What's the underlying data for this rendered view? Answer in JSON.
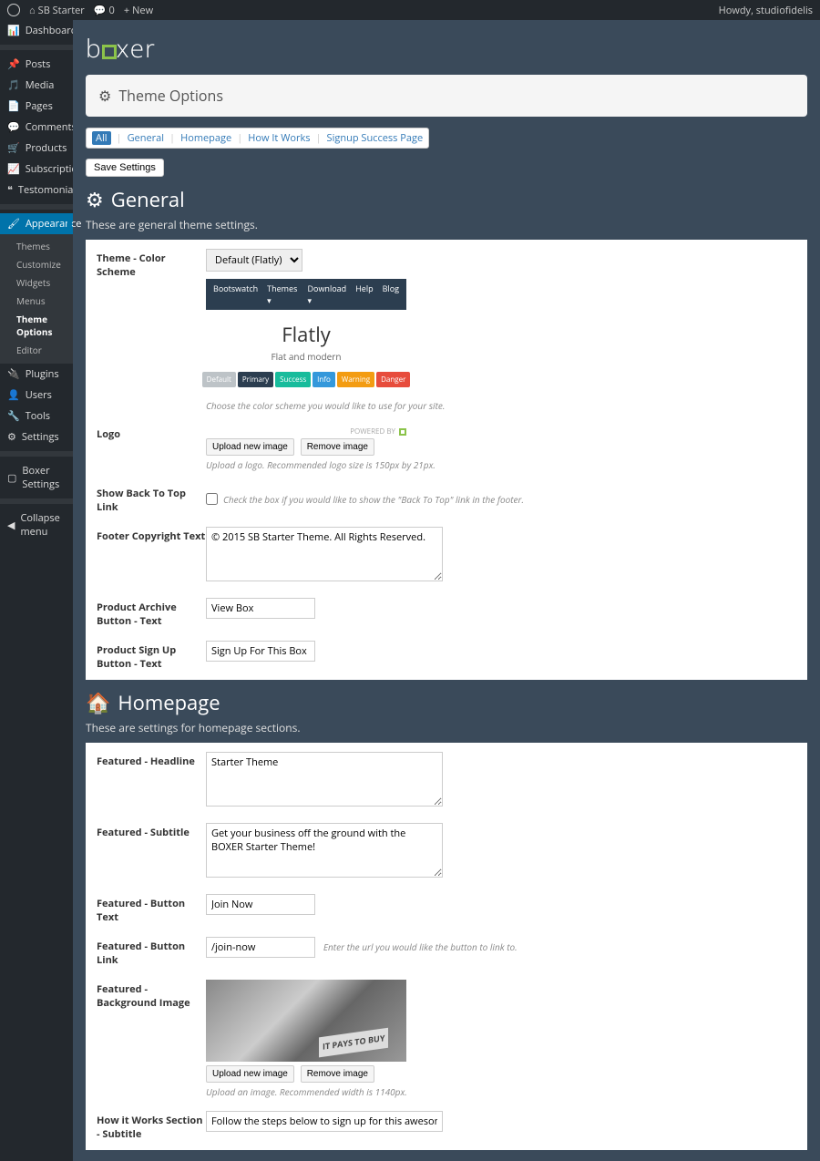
{
  "adminbar": {
    "site": "SB Starter",
    "comment_count": "0",
    "new": "New",
    "howdy": "Howdy, studiofidelis"
  },
  "sidebar": {
    "items": [
      {
        "icon": "dashboard",
        "label": "Dashboard"
      },
      {
        "icon": "pin",
        "label": "Posts"
      },
      {
        "icon": "media",
        "label": "Media"
      },
      {
        "icon": "page",
        "label": "Pages"
      },
      {
        "icon": "comment",
        "label": "Comments"
      },
      {
        "icon": "cart",
        "label": "Products"
      },
      {
        "icon": "chart",
        "label": "Subscriptions"
      },
      {
        "icon": "quote",
        "label": "Testomonials"
      },
      {
        "icon": "brush",
        "label": "Appearance"
      },
      {
        "icon": "plug",
        "label": "Plugins"
      },
      {
        "icon": "user",
        "label": "Users"
      },
      {
        "icon": "wrench",
        "label": "Tools"
      },
      {
        "icon": "gear",
        "label": "Settings"
      },
      {
        "icon": "box",
        "label": "Boxer Settings"
      },
      {
        "icon": "collapse",
        "label": "Collapse menu"
      }
    ],
    "submenu": [
      "Themes",
      "Customize",
      "Widgets",
      "Menus",
      "Theme Options",
      "Editor"
    ],
    "submenu_current": "Theme Options"
  },
  "header": {
    "brand": "boxer",
    "panel_title": "Theme Options"
  },
  "tabs": {
    "all": "All",
    "items": [
      "General",
      "Homepage",
      "How It Works",
      "Signup Success Page"
    ],
    "save": "Save Settings"
  },
  "general": {
    "title": "General",
    "desc": "These are general theme settings.",
    "color_scheme": {
      "label": "Theme - Color Scheme",
      "value": "Default (Flatly)",
      "preview_nav": [
        "Bootswatch",
        "Themes ▾",
        "Download ▾",
        "Help",
        "Blog"
      ],
      "preview_title": "Flatly",
      "preview_sub": "Flat and modern",
      "swatches": [
        {
          "name": "Default",
          "bg": "#bdc3c7"
        },
        {
          "name": "Primary",
          "bg": "#2c3e50"
        },
        {
          "name": "Success",
          "bg": "#18bc9c"
        },
        {
          "name": "Info",
          "bg": "#3498db"
        },
        {
          "name": "Warning",
          "bg": "#f39c12"
        },
        {
          "name": "Danger",
          "bg": "#e74c3c"
        }
      ],
      "hint": "Choose the color scheme you would like to use for your site."
    },
    "logo": {
      "label": "Logo",
      "powered": "POWERED BY",
      "upload": "Upload new image",
      "remove": "Remove image",
      "hint": "Upload a logo. Recommended logo size is 150px by 21px."
    },
    "back_to_top": {
      "label": "Show Back To Top Link",
      "text": "Check the box if you would like to show the \"Back To Top\" link in the footer."
    },
    "footer": {
      "label": "Footer Copyright Text",
      "value": "© 2015 SB Starter Theme. All Rights Reserved."
    },
    "archive_btn": {
      "label": "Product Archive Button - Text",
      "value": "View Box"
    },
    "signup_btn": {
      "label": "Product Sign Up Button - Text",
      "value": "Sign Up For This Box"
    }
  },
  "homepage": {
    "title": "Homepage",
    "desc": "These are settings for homepage sections.",
    "headline": {
      "label": "Featured - Headline",
      "value": "Starter Theme"
    },
    "subtitle": {
      "label": "Featured - Subtitle",
      "value": "Get your business off the ground with the BOXER Starter Theme!"
    },
    "btn_text": {
      "label": "Featured - Button Text",
      "value": "Join Now"
    },
    "btn_link": {
      "label": "Featured - Button Link",
      "value": "/join-now",
      "hint": "Enter the url you would like the button to link to."
    },
    "bg_image": {
      "label": "Featured - Background Image",
      "tag": "IT PAYS TO BUY",
      "upload": "Upload new image",
      "remove": "Remove image",
      "hint": "Upload an image. Recommended width is 1140px."
    },
    "howit_sub": {
      "label": "How it Works Section - Subtitle",
      "value": "Follow the steps below to sign up for this awesome box!"
    }
  }
}
